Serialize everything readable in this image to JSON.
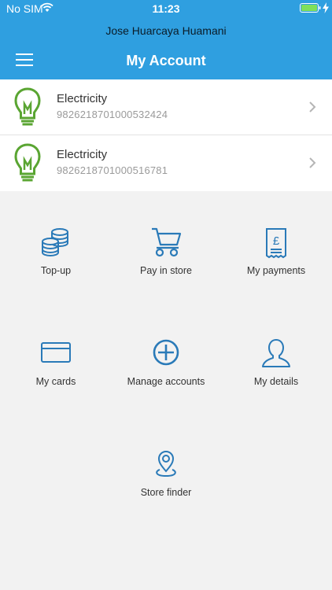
{
  "status_bar": {
    "carrier": "No SIM",
    "time": "11:23"
  },
  "header": {
    "user_name": "Jose Huarcaya Huamani",
    "title": "My Account"
  },
  "accounts": [
    {
      "type": "Electricity",
      "number": "9826218701000532424"
    },
    {
      "type": "Electricity",
      "number": "9826218701000516781"
    }
  ],
  "menu": {
    "topup": "Top-up",
    "pay_in_store": "Pay in store",
    "my_payments": "My payments",
    "my_cards": "My cards",
    "manage_accounts": "Manage accounts",
    "my_details": "My details",
    "store_finder": "Store finder"
  },
  "colors": {
    "header": "#2f9fe0",
    "icon_blue": "#2a7ab8",
    "bulb_green": "#5aa532",
    "background": "#f2f2f2"
  }
}
